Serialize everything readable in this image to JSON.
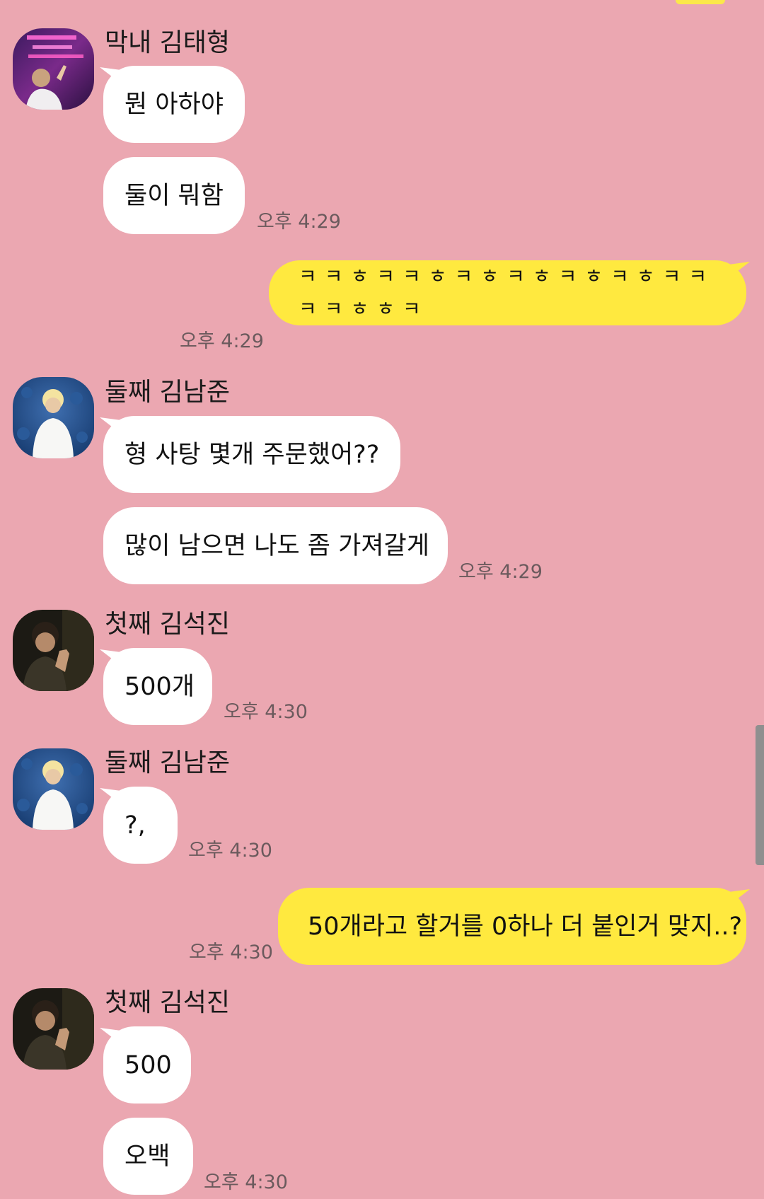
{
  "theme": {
    "background": "#EBA7B1",
    "incoming_bubble": "#FFFFFF",
    "outgoing_bubble": "#FFE93F"
  },
  "messages": [
    {
      "sender": "막내 김태형",
      "avatar": "taehyung-avatar",
      "texts": [
        "뭔 아하야",
        "둘이 뭐함"
      ],
      "time": "오후 4:29"
    },
    {
      "sender": "me",
      "texts": [
        "ㅋㅋㅎㅋㅋㅎㅋㅎㅋㅎㅋㅎㅋㅎㅋㅋㅋㅋㅎㅎㅋ"
      ],
      "time": "오후 4:29"
    },
    {
      "sender": "둘째 김남준",
      "avatar": "namjoon-avatar",
      "texts": [
        "형 사탕 몇개 주문했어??",
        "많이 남으면 나도 좀 가져갈게"
      ],
      "time": "오후 4:29"
    },
    {
      "sender": "첫째 김석진",
      "avatar": "seokjin-avatar",
      "texts": [
        "500개"
      ],
      "time": "오후 4:30"
    },
    {
      "sender": "둘째 김남준",
      "avatar": "namjoon-avatar",
      "texts": [
        "?,"
      ],
      "time": "오후 4:30"
    },
    {
      "sender": "me",
      "texts": [
        "50개라고 할거를 0하나 더 붙인거 맞지..?"
      ],
      "time": "오후 4:30"
    },
    {
      "sender": "첫째 김석진",
      "avatar": "seokjin-avatar",
      "texts": [
        "500",
        "오백"
      ],
      "time": "오후 4:30"
    }
  ]
}
